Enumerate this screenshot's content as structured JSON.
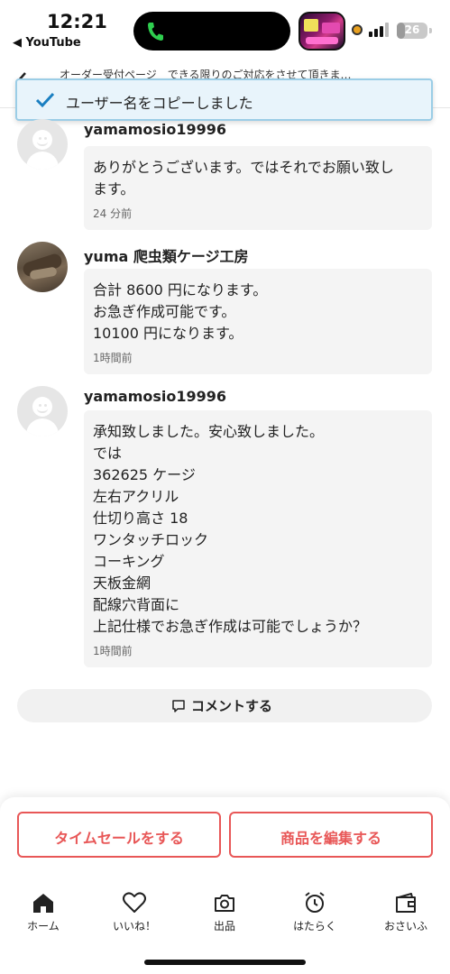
{
  "status_bar": {
    "time": "12:21",
    "back_app": "◀ YouTube",
    "battery": "26",
    "battery_level": 0.26
  },
  "header": {
    "title": "オーダー受付ページ　できる限りのご対応をさせて頂きま…"
  },
  "toast": {
    "message": "ユーザー名をコピーしました",
    "icon": "checkmark-icon"
  },
  "comments": [
    {
      "username": "yamamosio19996",
      "avatar": "default-avatar",
      "lines": [
        "ありがとうございます。ではそれでお願い致し",
        "ます。"
      ],
      "time": "24 分前"
    },
    {
      "username": "yuma 爬虫類ケージ工房",
      "avatar": "photo-avatar",
      "lines": [
        "合計 8600 円になります。",
        "お急ぎ作成可能です。",
        "10100 円になります。"
      ],
      "time": "1時間前"
    },
    {
      "username": "yamamosio19996",
      "avatar": "default-avatar",
      "lines": [
        "承知致しました。安心致しました。",
        "では",
        "362625 ケージ",
        "左右アクリル",
        "仕切り高さ 18",
        "ワンタッチロック",
        "コーキング",
        "天板金網",
        "配線穴背面に",
        "上記仕様でお急ぎ作成は可能でしょうか？"
      ],
      "time": "1時間前"
    }
  ],
  "comment_button": {
    "label": "コメントする",
    "icon": "speech-bubble-icon"
  },
  "actions": {
    "timesale_label": "タイムセールをする",
    "edit_label": "商品を編集する",
    "accent_color": "#e85757"
  },
  "tabbar": {
    "items": [
      {
        "label": "ホーム",
        "icon": "home-icon"
      },
      {
        "label": "いいね！",
        "icon": "heart-icon"
      },
      {
        "label": "出品",
        "icon": "camera-icon"
      },
      {
        "label": "はたらく",
        "icon": "alarm-clock-icon"
      },
      {
        "label": "おさいふ",
        "icon": "wallet-icon"
      }
    ]
  }
}
